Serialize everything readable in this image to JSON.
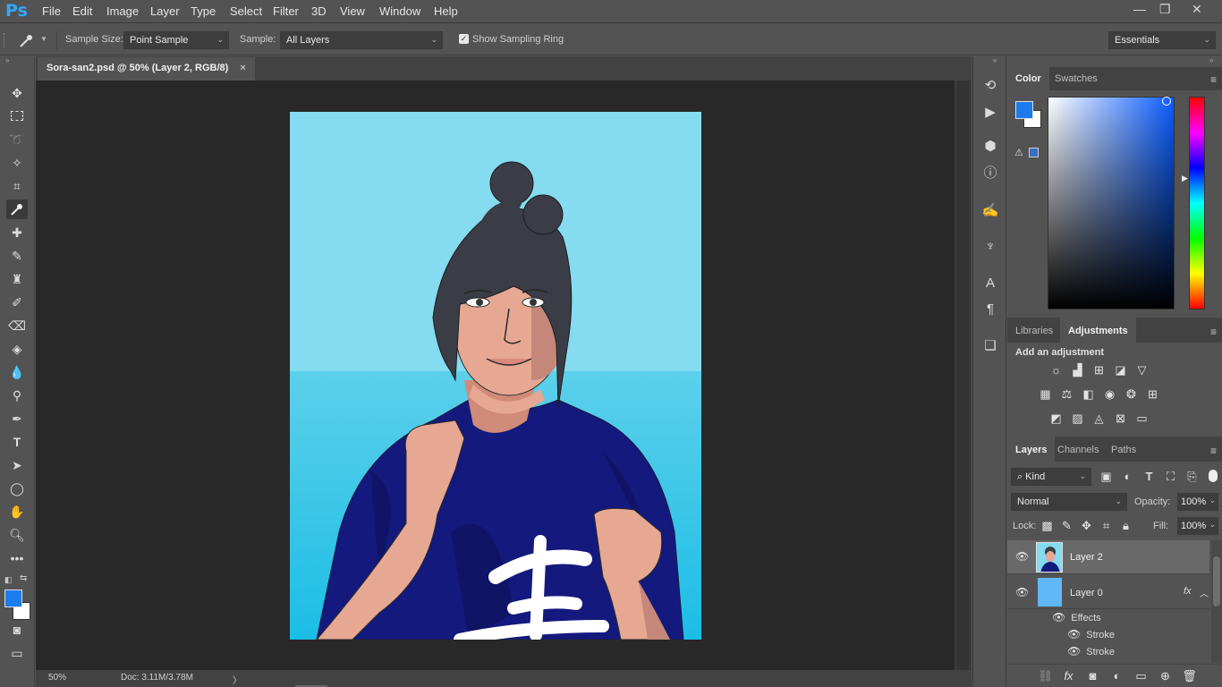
{
  "app": {
    "logo": "Ps",
    "accent": "#31a8ff"
  },
  "menu": [
    "File",
    "Edit",
    "Image",
    "Layer",
    "Type",
    "Select",
    "Filter",
    "3D",
    "View",
    "Window",
    "Help"
  ],
  "window_controls": {
    "minimize": "—",
    "restore": "❐",
    "close": "✕"
  },
  "options": {
    "sample_size_label": "Sample Size:",
    "sample_size_value": "Point Sample",
    "sample_label": "Sample:",
    "sample_value": "All Layers",
    "show_ring_label": "Show Sampling Ring",
    "show_ring_checked": true,
    "workspace": "Essentials"
  },
  "document": {
    "tab_title": "Sora-san2.psd @ 50% (Layer 2, RGB/8)",
    "close": "×"
  },
  "status": {
    "zoom": "50%",
    "doc": "Doc: 3.11M/3.78M",
    "arrow": "〉"
  },
  "colors": {
    "foreground": "#1c7ced",
    "background": "#ffffff",
    "canvas_bg": "#85dbef",
    "shirt": "#14197d"
  },
  "color_panel": {
    "tabs": [
      "Color",
      "Swatches"
    ],
    "active": "Color"
  },
  "adjust_panel": {
    "tabs": [
      "Libraries",
      "Adjustments"
    ],
    "active": "Adjustments",
    "heading": "Add an adjustment"
  },
  "layers_panel": {
    "tabs": [
      "Layers",
      "Channels",
      "Paths"
    ],
    "active": "Layers",
    "kind": "Kind",
    "blend_mode": "Normal",
    "opacity_label": "Opacity:",
    "opacity": "100%",
    "lock_label": "Lock:",
    "fill_label": "Fill:",
    "fill": "100%",
    "layers": [
      {
        "name": "Layer 2",
        "selected": true
      },
      {
        "name": "Layer 0",
        "fx": "fx"
      }
    ],
    "effects_label": "Effects",
    "effects": [
      "Stroke",
      "Stroke"
    ]
  }
}
